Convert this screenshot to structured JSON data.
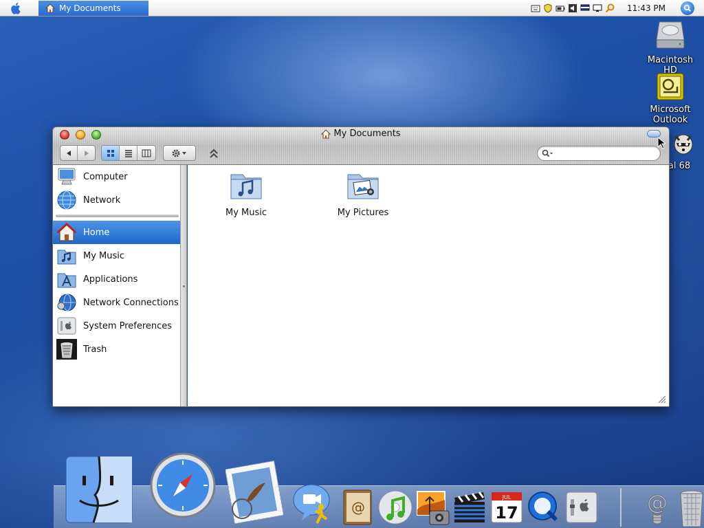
{
  "menubar": {
    "active_window": "My Documents",
    "clock": "11:43 PM",
    "status_icons": [
      "keyboard-icon",
      "shield-icon",
      "battery-icon",
      "volume-icon",
      "display-icon",
      "monitor-icon",
      "key-icon"
    ]
  },
  "desktop": {
    "items": [
      {
        "label": "Macintosh HD",
        "icon": "hard-drive-icon"
      },
      {
        "label": "Microsoft Outlook",
        "icon": "outlook-icon"
      },
      {
        "label": "al 68",
        "icon": "raccoon-icon"
      }
    ]
  },
  "window": {
    "title": "My Documents",
    "search_placeholder": "",
    "sidebar": {
      "devices": [
        {
          "label": "Computer",
          "icon": "computer-icon"
        },
        {
          "label": "Network",
          "icon": "globe-icon"
        }
      ],
      "places": [
        {
          "label": "Home",
          "icon": "home-icon",
          "selected": true
        },
        {
          "label": "My Music",
          "icon": "music-folder-icon"
        },
        {
          "label": "Applications",
          "icon": "applications-icon"
        },
        {
          "label": "Network Connections",
          "icon": "network-connections-icon"
        },
        {
          "label": "System Preferences",
          "icon": "system-preferences-icon"
        },
        {
          "label": "Trash",
          "icon": "trash-icon"
        }
      ]
    },
    "files": [
      {
        "label": "My Music",
        "icon": "music-folder-icon"
      },
      {
        "label": "My Pictures",
        "icon": "pictures-folder-icon"
      }
    ],
    "view_mode": "icon"
  },
  "dock": {
    "items": [
      "finder-icon",
      "safari-icon",
      "mail-icon",
      "ichat-icon",
      "address-book-icon",
      "itunes-icon",
      "iphoto-icon",
      "imovie-icon",
      "ical-icon",
      "quicktime-icon",
      "system-preferences-icon",
      "mail-alias-icon",
      "trash-icon"
    ]
  },
  "colors": {
    "selection": "#2a6bd0",
    "desktop": "#1d4fa6"
  }
}
